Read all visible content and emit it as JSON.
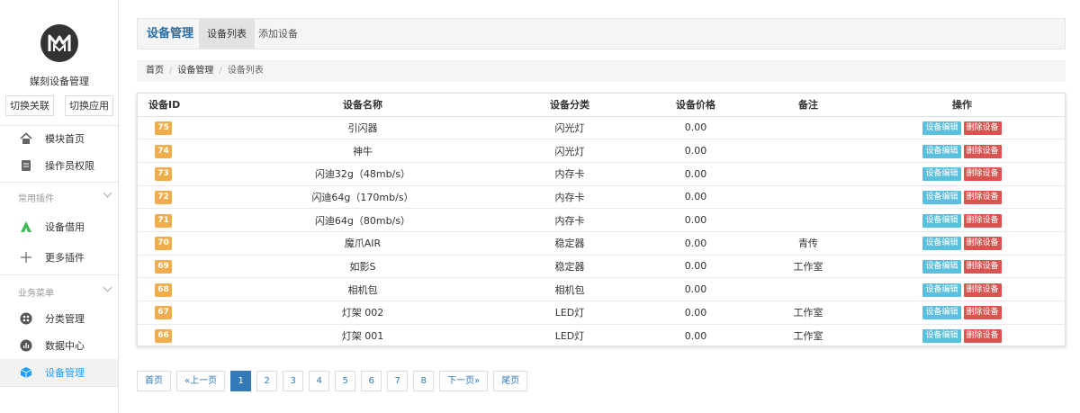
{
  "sidebar": {
    "app_name": "媒刻设备管理",
    "switch_buttons": [
      "切换关联",
      "切换应用"
    ],
    "top_items": [
      {
        "label": "模块首页",
        "icon": "home-icon"
      },
      {
        "label": "操作员权限",
        "icon": "document-icon"
      }
    ],
    "groups": [
      {
        "title": "常用插件",
        "items": [
          {
            "label": "设备借用",
            "icon": "triangle-logo-icon"
          },
          {
            "label": "更多插件",
            "icon": "plus-icon"
          }
        ]
      },
      {
        "title": "业务菜单",
        "items": [
          {
            "label": "分类管理",
            "icon": "grid-circle-icon"
          },
          {
            "label": "数据中心",
            "icon": "chart-circle-icon"
          },
          {
            "label": "设备管理",
            "icon": "cube-icon",
            "active": true
          }
        ]
      }
    ]
  },
  "header": {
    "title": "设备管理",
    "tabs": [
      "设备列表",
      "添加设备"
    ]
  },
  "breadcrumb": [
    "首页",
    "设备管理",
    "设备列表"
  ],
  "table": {
    "columns": [
      "设备ID",
      "设备名称",
      "设备分类",
      "设备价格",
      "备注",
      "操作"
    ],
    "edit_label": "设备编辑",
    "delete_label": "删除设备",
    "rows": [
      {
        "id": "75",
        "name": "引闪器",
        "category": "闪光灯",
        "price": "0.00",
        "note": ""
      },
      {
        "id": "74",
        "name": "神牛",
        "category": "闪光灯",
        "price": "0.00",
        "note": ""
      },
      {
        "id": "73",
        "name": "闪迪32g（48mb/s）",
        "category": "内存卡",
        "price": "0.00",
        "note": ""
      },
      {
        "id": "72",
        "name": "闪迪64g（170mb/s）",
        "category": "内存卡",
        "price": "0.00",
        "note": ""
      },
      {
        "id": "71",
        "name": "闪迪64g（80mb/s）",
        "category": "内存卡",
        "price": "0.00",
        "note": ""
      },
      {
        "id": "70",
        "name": "魔爪AIR",
        "category": "稳定器",
        "price": "0.00",
        "note": "青传"
      },
      {
        "id": "69",
        "name": "如影S",
        "category": "稳定器",
        "price": "0.00",
        "note": "工作室"
      },
      {
        "id": "68",
        "name": "相机包",
        "category": "相机包",
        "price": "0.00",
        "note": ""
      },
      {
        "id": "67",
        "name": "灯架 002",
        "category": "LED灯",
        "price": "0.00",
        "note": "工作室"
      },
      {
        "id": "66",
        "name": "灯架 001",
        "category": "LED灯",
        "price": "0.00",
        "note": "工作室"
      }
    ]
  },
  "pagination": {
    "first": "首页",
    "prev": "«上一页",
    "pages": [
      "1",
      "2",
      "3",
      "4",
      "5",
      "6",
      "7",
      "8"
    ],
    "current": "1",
    "next": "下一页»",
    "last": "尾页"
  },
  "colors": {
    "accent": "#337ab7",
    "id_badge": "#f0ad4e",
    "edit": "#5bc0de",
    "delete": "#d9534f"
  }
}
